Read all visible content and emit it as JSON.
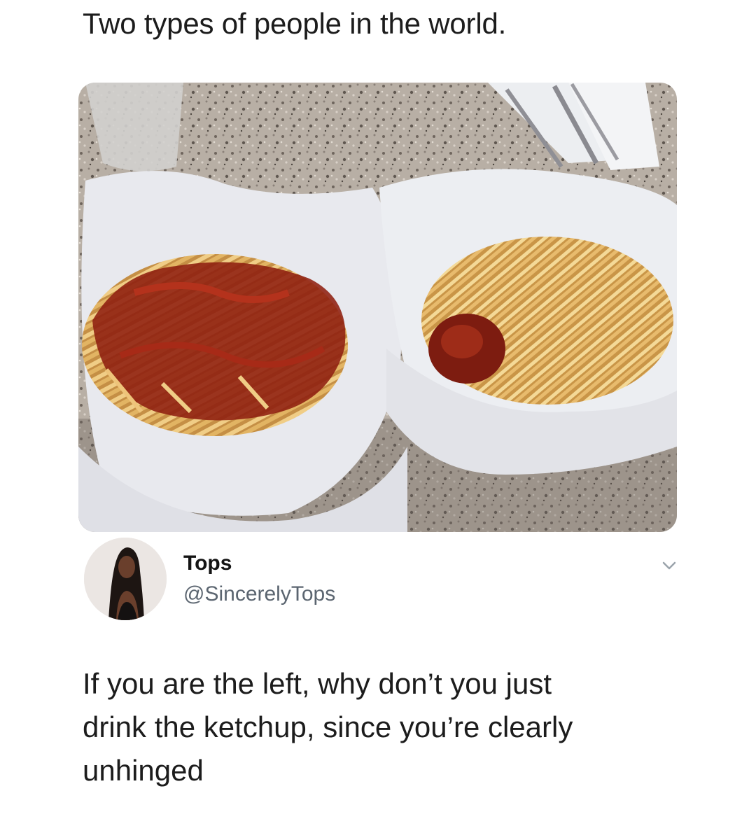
{
  "post": {
    "caption": "Two types of people in the world.",
    "image_description_icon": "fries-photo",
    "author": {
      "display_name": "Tops",
      "handle": "@SincerelyTops"
    },
    "text_lines": [
      "If you are the left, why don’t you just",
      "drink the ketchup, since you’re clearly",
      "unhinged"
    ]
  },
  "colors": {
    "text": "#1c1c1c",
    "handle": "#5b6570",
    "ketchup": "#8e1f10",
    "fries": "#e3b463",
    "paper": "#e8e9ee",
    "counter": "#b7aea4"
  }
}
